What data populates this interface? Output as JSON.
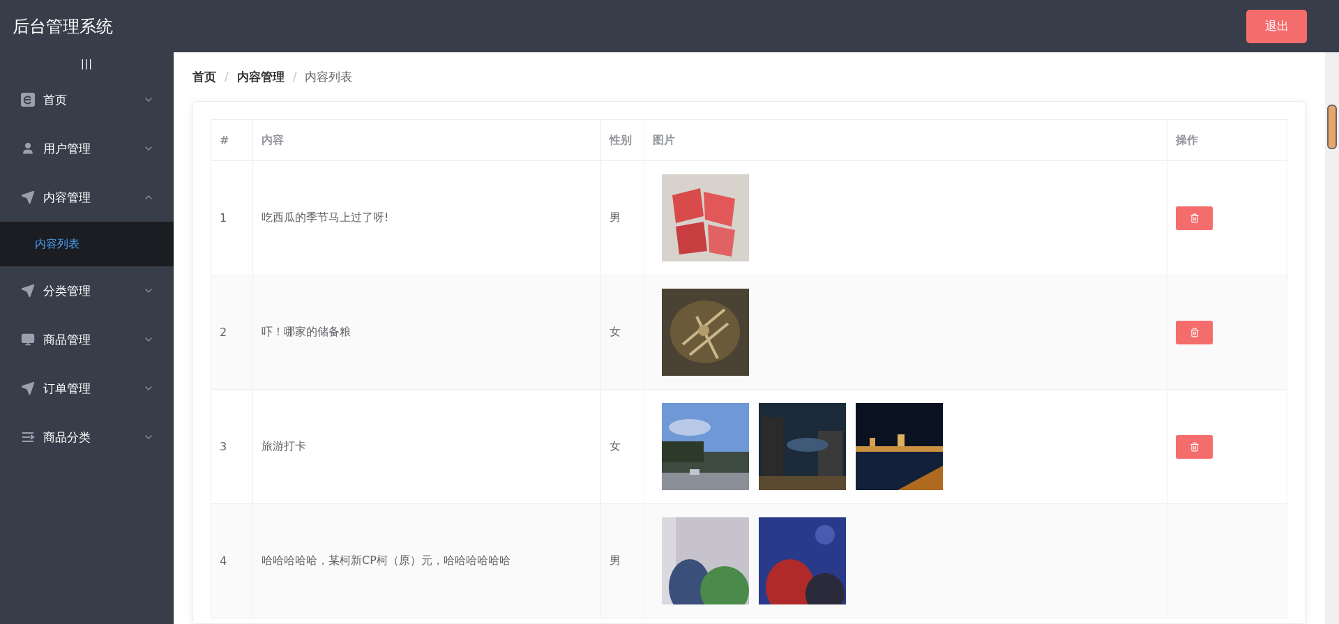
{
  "header": {
    "title": "后台管理系统",
    "logout": "退出"
  },
  "sidebar": {
    "toggle": "|||",
    "items": [
      {
        "kind": "home",
        "label": "首页",
        "expanded": false
      },
      {
        "kind": "user",
        "label": "用户管理",
        "expanded": false
      },
      {
        "kind": "send",
        "label": "内容管理",
        "expanded": true,
        "children": [
          {
            "label": "内容列表",
            "selected": true
          }
        ]
      },
      {
        "kind": "send",
        "label": "分类管理",
        "expanded": false
      },
      {
        "kind": "monitor",
        "label": "商品管理",
        "expanded": false
      },
      {
        "kind": "send",
        "label": "订单管理",
        "expanded": false
      },
      {
        "kind": "list",
        "label": "商品分类",
        "expanded": false
      }
    ]
  },
  "breadcrumb": [
    {
      "label": "首页",
      "current": false
    },
    {
      "separator": "/",
      "label": "内容管理",
      "current": false
    },
    {
      "separator": "/",
      "label": "内容列表",
      "current": true
    }
  ],
  "table": {
    "columns": [
      "#",
      "内容",
      "性别",
      "图片",
      "操作"
    ],
    "rows": [
      {
        "index": "1",
        "content": "吃西瓜的季节马上过了呀!",
        "gender": "男",
        "delete_button": true
      },
      {
        "index": "2",
        "content": "吓！哪家的储备粮",
        "gender": "女",
        "delete_button": true
      },
      {
        "index": "3",
        "content": "旅游打卡",
        "gender": "女",
        "delete_button": true
      },
      {
        "index": "4",
        "content": "哈哈哈哈哈，某柯新CP柯（原）元，哈哈哈哈哈哈",
        "gender": "男"
      }
    ]
  }
}
